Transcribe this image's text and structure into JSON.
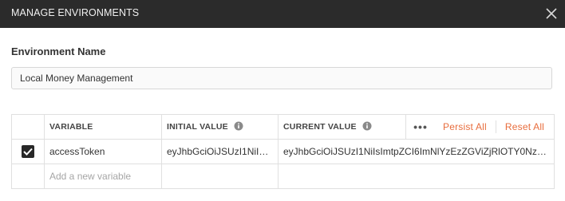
{
  "modal": {
    "title": "MANAGE ENVIRONMENTS",
    "close_icon": "close-icon"
  },
  "environment": {
    "label": "Environment Name",
    "value": "Local Money Management"
  },
  "table": {
    "headers": {
      "variable": "VARIABLE",
      "initial_value": "INITIAL VALUE",
      "current_value": "CURRENT VALUE",
      "more": "•••",
      "persist_all": "Persist All",
      "reset_all": "Reset All"
    },
    "rows": [
      {
        "enabled": true,
        "variable": "accessToken",
        "initial_value": "eyJhbGciOiJSUzI1NiIsI...",
        "current_value": "eyJhbGciOiJSUzI1NiIsImtpZCI6ImNlYzEzZGViZjRlOTY0Nzk2..."
      }
    ],
    "new_row_placeholder": "Add a new variable"
  },
  "colors": {
    "header_bg": "#2b2b2b",
    "accent": "#e86d3d",
    "checkbox": "#282828"
  }
}
